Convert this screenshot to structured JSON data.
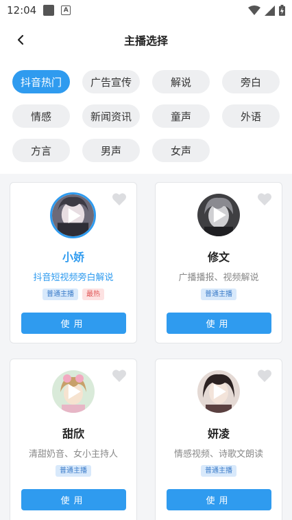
{
  "status_bar": {
    "time": "12:04"
  },
  "header": {
    "title": "主播选择"
  },
  "chips": [
    "抖音热门",
    "广告宣传",
    "解说",
    "旁白",
    "情感",
    "新闻资讯",
    "童声",
    "外语",
    "方言",
    "男声",
    "女声"
  ],
  "cards": [
    {
      "name": "小娇",
      "desc": "抖音短视频旁白解说",
      "tag": "普通主播",
      "hot_tag": "最热",
      "button": "使用"
    },
    {
      "name": "修文",
      "desc": "广播播报、视频解说",
      "tag": "普通主播",
      "button": "使用"
    },
    {
      "name": "甜欣",
      "desc": "清甜奶音、女小主持人",
      "tag": "普通主播",
      "button": "使用"
    },
    {
      "name": "妍凌",
      "desc": "情感视频、诗歌文朗读",
      "tag": "普通主播",
      "button": "使用"
    }
  ],
  "colors": {
    "accent": "#2f9bef",
    "hot": "#e05555",
    "chip_bg": "#eeeff1",
    "content_bg": "#f4f5f7"
  },
  "icons": [
    "back-arrow-icon",
    "heart-icon",
    "play-icon",
    "wifi-icon",
    "signal-icon",
    "battery-icon"
  ]
}
